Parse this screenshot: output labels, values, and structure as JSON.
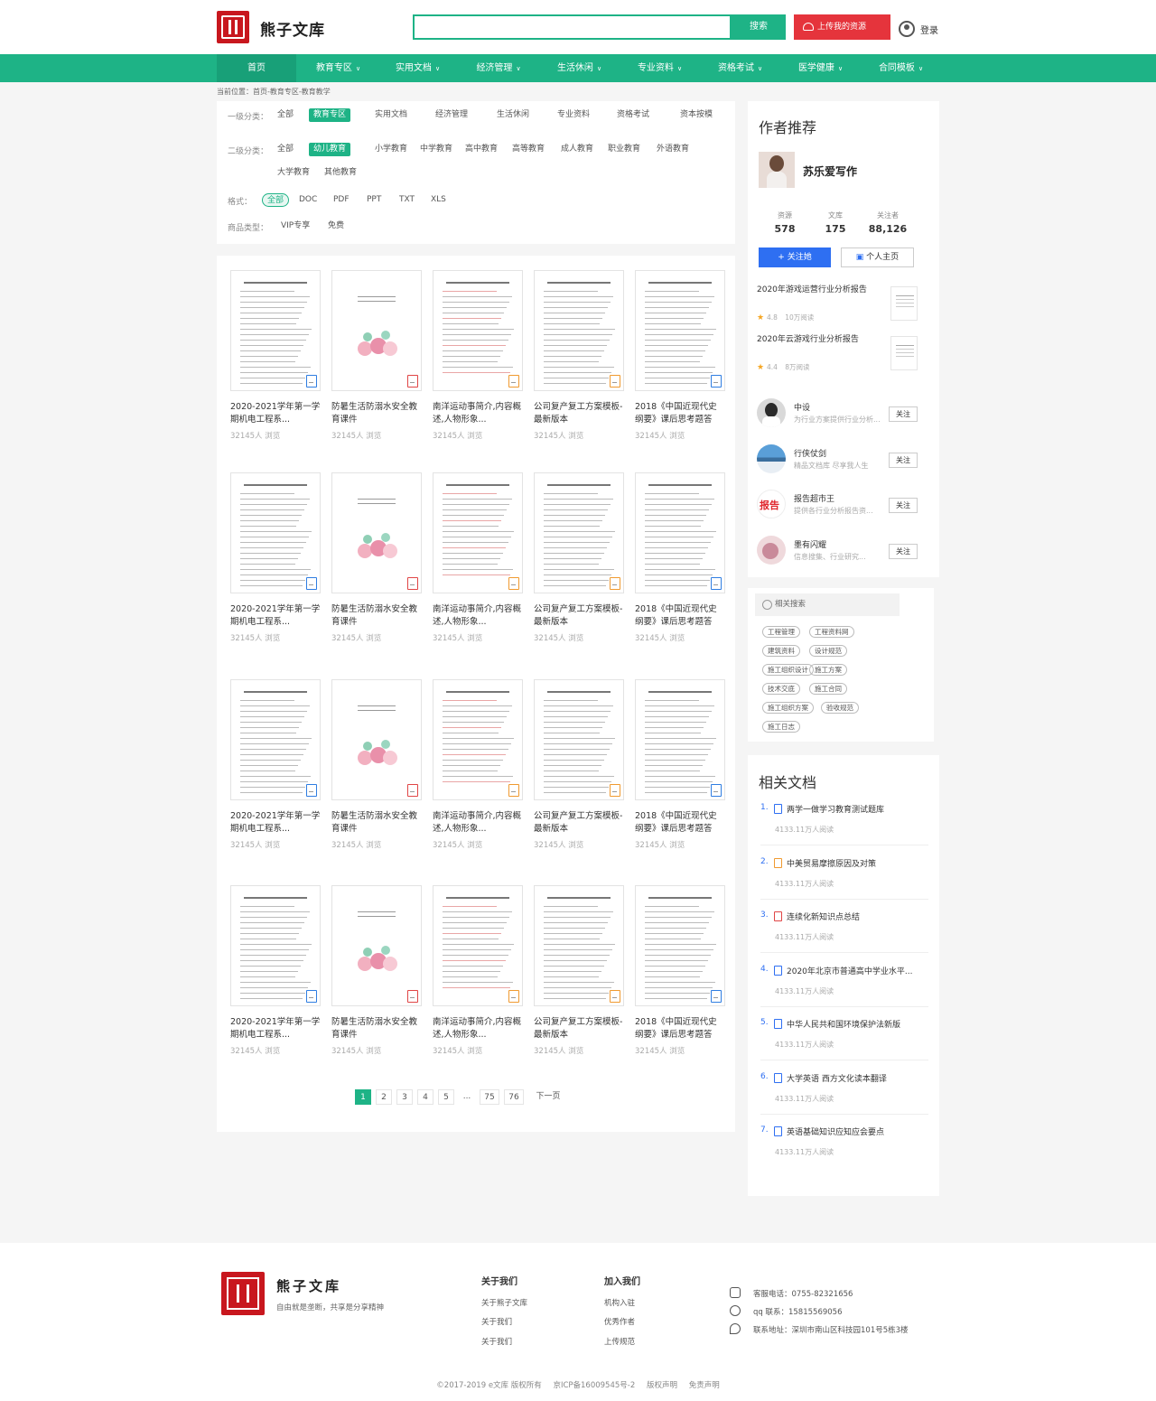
{
  "header": {
    "brand": "熊子文库",
    "search_placeholder": "",
    "search_button": "搜索",
    "upload_button": "上传我的资源",
    "login_label": "登录"
  },
  "nav": {
    "items": [
      "首页",
      "教育专区",
      "实用文档",
      "经济管理",
      "生活休闲",
      "专业资料",
      "资格考试",
      "医学健康",
      "合同模板"
    ]
  },
  "breadcrumb": "当前位置：首页-教育专区-教育教学",
  "filters": {
    "row1_label": "一级分类：",
    "row1_options": [
      "全部",
      "教育专区",
      "实用文档",
      "经济管理",
      "生活休闲",
      "专业资料",
      "资格考试",
      "资本按模"
    ],
    "row1_selected": "教育专区",
    "row2_label": "二级分类：",
    "row2_options": [
      "全部",
      "幼儿教育",
      "小学教育",
      "中学教育",
      "高中教育",
      "高等教育",
      "成人教育",
      "职业教育",
      "外语教育",
      "大学教育",
      "其他教育"
    ],
    "row2_selected": "幼儿教育",
    "row3_label": "格式：",
    "row3_options": [
      "全部",
      "DOC",
      "PDF",
      "PPT",
      "TXT",
      "XLS"
    ],
    "row3_selected": "全部",
    "row4_label": "商品类型：",
    "row4_options": [
      "VIP专享",
      "免费"
    ]
  },
  "documents": {
    "rows": 4,
    "items": [
      {
        "title": "2020-2021学年第一学期机电工程系...",
        "meta": "32145人 浏览",
        "type": "doc"
      },
      {
        "title": "防暑生活防溺水安全教育课件",
        "meta": "32145人 浏览",
        "type": "pdf"
      },
      {
        "title": "南洋运动事简介,内容概述,人物形象...",
        "meta": "32145人 浏览",
        "type": "ppt"
      },
      {
        "title": "公司复产复工方案模板-最新版本",
        "meta": "32145人 浏览",
        "type": "ppt"
      },
      {
        "title": "2018《中国近现代史纲要》课后思考题答案...",
        "meta": "32145人 浏览",
        "type": "doc"
      }
    ]
  },
  "pagination": {
    "pages": [
      "1",
      "2",
      "3",
      "4",
      "5",
      "...",
      "75",
      "76"
    ],
    "current": "1",
    "next_label": "下一页"
  },
  "author": {
    "heading": "作者推荐",
    "name": "苏乐爱写作",
    "stats": [
      {
        "label": "资源",
        "value": "578"
      },
      {
        "label": "文库",
        "value": "175"
      },
      {
        "label": "关注者",
        "value": "88,126"
      }
    ],
    "follow_label": "关注她",
    "home_label": "个人主页",
    "recs": [
      {
        "title": "2020年游戏运营行业分析报告",
        "rating": "4.8",
        "views": "10万阅读"
      },
      {
        "title": "2020年云游戏行业分析报告",
        "rating": "4.4",
        "views": "8万阅读"
      }
    ],
    "others": [
      {
        "name": "中设",
        "desc": "为行业方案提供行业分析...",
        "btn": "关注"
      },
      {
        "name": "行侠仗剑",
        "desc": "精品文档库 尽享我人生",
        "btn": "关注"
      },
      {
        "name": "报告超市王",
        "desc": "提供各行业分析报告资...",
        "btn": "关注"
      },
      {
        "name": "墨有闪耀",
        "desc": "信息搜集、行业研究...",
        "btn": "关注"
      }
    ]
  },
  "tags": {
    "heading": "相关搜索",
    "items": [
      "工程管理",
      "工程资料网",
      "建筑资料",
      "设计规范",
      "施工组织设计",
      "施工方案",
      "技术交底",
      "施工合同",
      "施工组织方案",
      "验收规范",
      "施工日志"
    ]
  },
  "related": {
    "heading": "相关文档",
    "items": [
      {
        "num": "1.",
        "title": "两学一做学习教育测试题库",
        "meta": "4133.11万人阅读",
        "type": "doc"
      },
      {
        "num": "2.",
        "title": "中美贸易摩擦原因及对策",
        "meta": "4133.11万人阅读",
        "type": "ppt"
      },
      {
        "num": "3.",
        "title": "连续化新知识点总结",
        "meta": "4133.11万人阅读",
        "type": "pdf"
      },
      {
        "num": "4.",
        "title": "2020年北京市普通高中学业水平...",
        "meta": "4133.11万人阅读",
        "type": "doc"
      },
      {
        "num": "5.",
        "title": "中华人民共和国环境保护法新版",
        "meta": "4133.11万人阅读",
        "type": "doc"
      },
      {
        "num": "6.",
        "title": "大学英语 西方文化读本翻译",
        "meta": "4133.11万人阅读",
        "type": "doc"
      },
      {
        "num": "7.",
        "title": "英语基础知识应知应会要点",
        "meta": "4133.11万人阅读",
        "type": "doc"
      }
    ]
  },
  "footer": {
    "brand": "熊子文库",
    "slogan": "自由就是垄断，共享是分享精神",
    "about_heading": "关于我们",
    "about_links": [
      "关于熊子文库",
      "关于我们",
      "关于我们"
    ],
    "join_heading": "加入我们",
    "join_links": [
      "机构入驻",
      "优秀作者",
      "上传规范"
    ],
    "phone": "客服电话：0755-82321656",
    "qq": "qq 联系：15815569056",
    "address": "联系地址：深圳市南山区科技园101号5栋3楼",
    "copyright": "©2017-2019 e文库 版权所有",
    "icp": "京ICP备16009545号-2",
    "copyright_notice": "版权声明",
    "disclaimer": "免责声明"
  },
  "colors": {
    "primary": "#1eb386",
    "upload": "#e5343c",
    "link": "#2e6ff2"
  }
}
